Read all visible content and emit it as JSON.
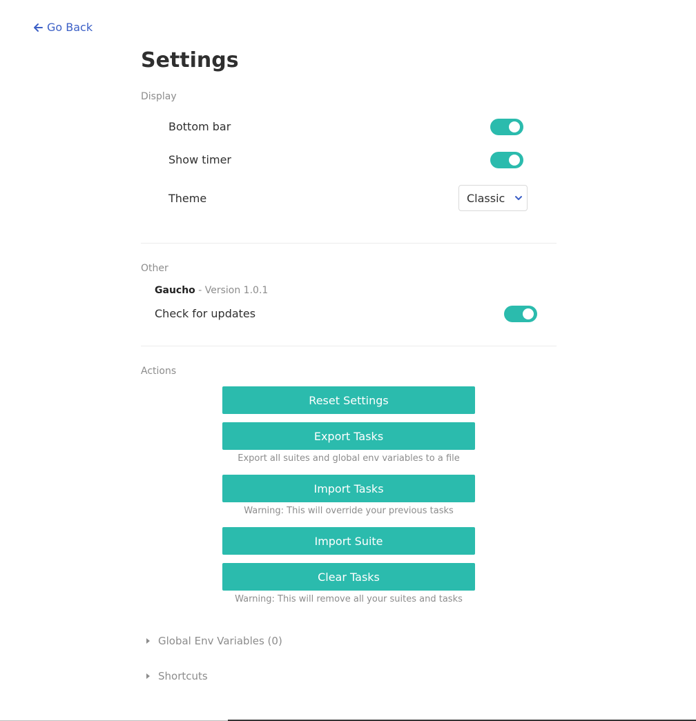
{
  "nav": {
    "back_label": "Go Back"
  },
  "page": {
    "title": "Settings"
  },
  "display": {
    "section_label": "Display",
    "bottom_bar": {
      "label": "Bottom bar",
      "enabled": true
    },
    "show_timer": {
      "label": "Show timer",
      "enabled": true
    },
    "theme": {
      "label": "Theme",
      "selected": "Classic"
    }
  },
  "other": {
    "section_label": "Other",
    "app_name": "Gaucho",
    "version_text": " - Version 1.0.1",
    "check_updates": {
      "label": "Check for updates",
      "enabled": true
    }
  },
  "actions": {
    "section_label": "Actions",
    "reset_label": "Reset Settings",
    "export_label": "Export Tasks",
    "export_hint": "Export all suites and global env variables to a file",
    "import_tasks_label": "Import Tasks",
    "import_tasks_hint": "Warning: This will override your previous tasks",
    "import_suite_label": "Import Suite",
    "clear_label": "Clear Tasks",
    "clear_hint": "Warning: This will remove all your suites and tasks"
  },
  "collapsibles": {
    "env_label": "Global Env Variables (0)",
    "shortcuts_label": "Shortcuts"
  },
  "colors": {
    "accent": "#2bbbad",
    "link": "#3b5fc6"
  },
  "icons": {
    "back": "arrow-left-icon",
    "dropdown": "chevron-down-icon",
    "collapse": "caret-right-icon"
  }
}
